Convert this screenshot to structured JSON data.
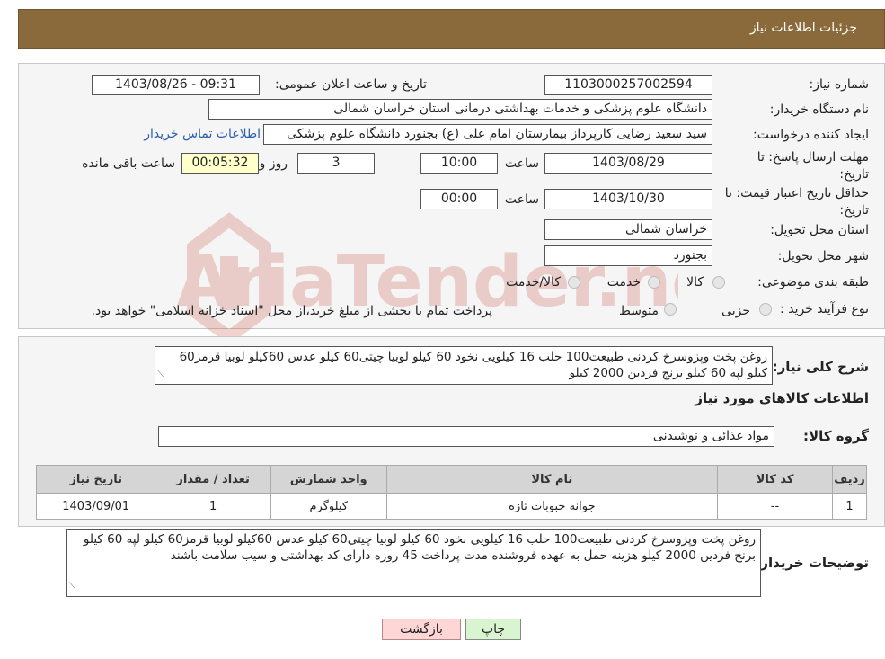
{
  "header": {
    "title": "جزئیات اطلاعات نیاز"
  },
  "form": {
    "need_number_label": "شماره نیاز:",
    "need_number": "1103000257002594",
    "announce_label": "تاریخ و ساعت اعلان عمومی:",
    "announce_value": "1403/08/26 - 09:31",
    "buyer_org_label": "نام دستگاه خریدار:",
    "buyer_org": "دانشگاه علوم پزشکی و خدمات بهداشتی درمانی استان خراسان شمالی",
    "requester_label": "ایجاد کننده درخواست:",
    "requester": "سید سعید رضایی کارپرداز بیمارستان امام علی (ع) بجنورد دانشگاه علوم پزشکی",
    "contact_link": "اطلاعات تماس خریدار",
    "deadline_label": "مهلت ارسال پاسخ: تا تاریخ:",
    "deadline_date": "1403/08/29",
    "time_label": "ساعت",
    "deadline_time": "10:00",
    "days_value": "3",
    "days_label": "روز و",
    "remaining_time": "00:05:32",
    "remaining_label": "ساعت باقی مانده",
    "validity_label": "حداقل تاریخ اعتبار قیمت: تا تاریخ:",
    "validity_date": "1403/10/30",
    "validity_time": "00:00",
    "province_label": "استان محل تحویل:",
    "province": "خراسان شمالی",
    "city_label": "شهر محل تحویل:",
    "city": "بجنورد",
    "category_label": "طبقه بندی موضوعی:",
    "category_options": [
      "کالا",
      "خدمت",
      "کالا/خدمت"
    ],
    "process_label": "نوع فرآیند خرید :",
    "process_options": [
      "جزیی",
      "متوسط"
    ],
    "process_note": "پرداخت تمام یا بخشی از مبلغ خرید،از محل \"اسناد خزانه اسلامی\" خواهد بود."
  },
  "summary": {
    "label": "شرح کلی نیاز:",
    "text": "روغن پخت وپزوسرخ کردنی طبیعت100 حلب 16 کیلویی نخود 60 کیلو لوبیا چیتی60 کیلو عدس 60کیلو  لوبیا قرمز60 کیلو لپه 60 کیلو  برنج فردین 2000 کیلو",
    "goods_info_title": "اطلاعات کالاهای مورد نیاز",
    "group_label": "گروه کالا:",
    "group_value": "مواد غذائی و نوشیدنی"
  },
  "table": {
    "headers": [
      "ردیف",
      "کد کالا",
      "نام کالا",
      "واحد شمارش",
      "تعداد / مقدار",
      "تاریخ نیاز"
    ],
    "rows": [
      {
        "row": "1",
        "code": "--",
        "name": "جوانه حبوبات تازه",
        "unit": "کیلوگرم",
        "qty": "1",
        "date": "1403/09/01"
      }
    ]
  },
  "buyer_notes": {
    "label": "توضیحات خریدار:",
    "text": "روغن پخت وپزوسرخ کردنی طبیعت100 حلب 16 کیلویی نخود 60 کیلو لوبیا چیتی60 کیلو عدس 60کیلو  لوبیا قرمز60 کیلو لپه 60 کیلو  برنج فردین 2000 کیلو  هزینه حمل به عهده فروشنده مدت پرداخت 45 روزه دارای کد بهداشتی و سیب سلامت باشند"
  },
  "buttons": {
    "print": "چاپ",
    "back": "بازگشت"
  },
  "colors": {
    "header_bg": "#8a6a3b",
    "back_button_bg": "#ffd6d6",
    "print_button_bg": "#d8f5d0",
    "remaining_bg": "#ffffcc",
    "watermark": "#c0392b"
  }
}
